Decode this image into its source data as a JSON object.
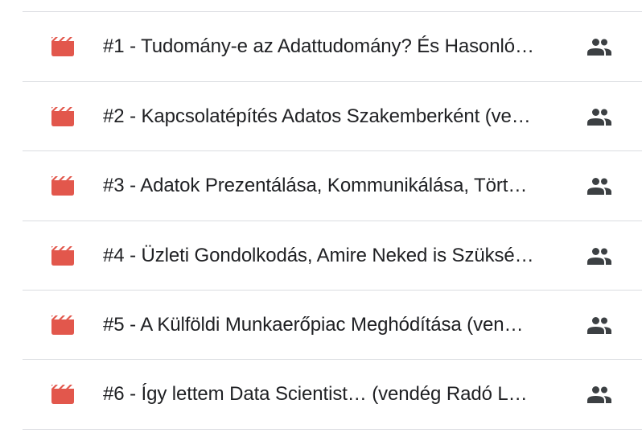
{
  "colors": {
    "video_icon": "#e2574c",
    "text": "#202124",
    "shared_icon": "#3c4043",
    "divider": "#dadce0"
  },
  "files": [
    {
      "name": "#1 - Tudomány-e az Adattudomány? És Hasonló…",
      "icon": "video-icon",
      "shared_icon": "people-icon"
    },
    {
      "name": "#2 - Kapcsolatépítés Adatos Szakemberként (ve…",
      "icon": "video-icon",
      "shared_icon": "people-icon"
    },
    {
      "name": "#3 - Adatok Prezentálása, Kommunikálása, Tört…",
      "icon": "video-icon",
      "shared_icon": "people-icon"
    },
    {
      "name": "#4 - Üzleti Gondolkodás, Amire Neked is Szüksé…",
      "icon": "video-icon",
      "shared_icon": "people-icon"
    },
    {
      "name": "#5 - A Külföldi Munkaerőpiac Meghódítása (ven…",
      "icon": "video-icon",
      "shared_icon": "people-icon"
    },
    {
      "name": "#6 - Így lettem Data Scientist… (vendég Radó L…",
      "icon": "video-icon",
      "shared_icon": "people-icon"
    }
  ]
}
